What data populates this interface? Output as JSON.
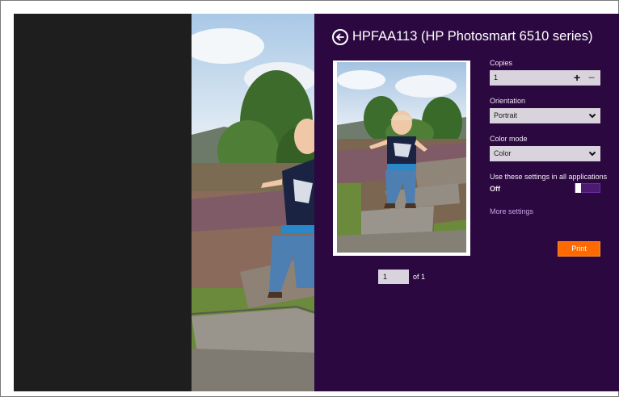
{
  "panel": {
    "title": "HPFAA113 (HP Photosmart 6510 series)",
    "back_icon": "back-arrow-icon",
    "copies": {
      "label": "Copies",
      "value": "1",
      "plus": "+",
      "minus": "−"
    },
    "orientation": {
      "label": "Orientation",
      "value": "Portrait"
    },
    "color_mode": {
      "label": "Color mode",
      "value": "Color"
    },
    "use_settings": {
      "label": "Use these settings in all applications",
      "state": "Off"
    },
    "more_settings": "More settings",
    "print_label": "Print",
    "page": {
      "current": "1",
      "of_text": "of 1"
    }
  },
  "colors": {
    "panel_bg": "#2c0840",
    "print_button": "#ff6a00",
    "field_bg": "#d8d3dc",
    "link": "#c9a2e6"
  }
}
